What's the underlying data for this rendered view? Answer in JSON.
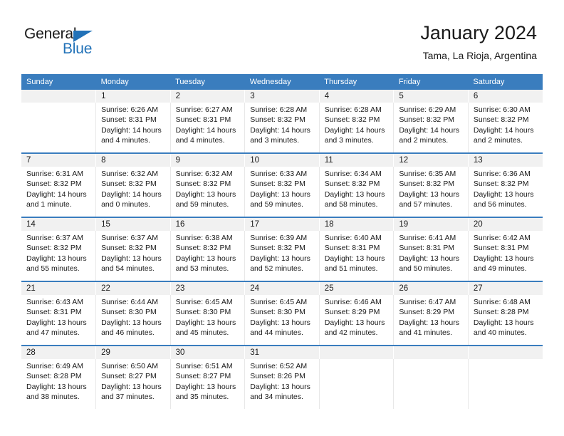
{
  "logo": {
    "word_primary": "General",
    "word_secondary": "Blue",
    "primary_color": "#1b1b1b",
    "accent_color": "#2272b8"
  },
  "header": {
    "title": "January 2024",
    "subtitle": "Tama, La Rioja, Argentina"
  },
  "theme": {
    "header_blue": "#3a7dbe",
    "daynum_gray": "#f1f1f1",
    "text": "#1a1a1a"
  },
  "weekday_headers": [
    "Sunday",
    "Monday",
    "Tuesday",
    "Wednesday",
    "Thursday",
    "Friday",
    "Saturday"
  ],
  "weeks": [
    {
      "days": [
        {
          "num": "",
          "sunrise": "",
          "sunset": "",
          "daylight1": "",
          "daylight2": ""
        },
        {
          "num": "1",
          "sunrise": "Sunrise: 6:26 AM",
          "sunset": "Sunset: 8:31 PM",
          "daylight1": "Daylight: 14 hours",
          "daylight2": "and 4 minutes."
        },
        {
          "num": "2",
          "sunrise": "Sunrise: 6:27 AM",
          "sunset": "Sunset: 8:31 PM",
          "daylight1": "Daylight: 14 hours",
          "daylight2": "and 4 minutes."
        },
        {
          "num": "3",
          "sunrise": "Sunrise: 6:28 AM",
          "sunset": "Sunset: 8:32 PM",
          "daylight1": "Daylight: 14 hours",
          "daylight2": "and 3 minutes."
        },
        {
          "num": "4",
          "sunrise": "Sunrise: 6:28 AM",
          "sunset": "Sunset: 8:32 PM",
          "daylight1": "Daylight: 14 hours",
          "daylight2": "and 3 minutes."
        },
        {
          "num": "5",
          "sunrise": "Sunrise: 6:29 AM",
          "sunset": "Sunset: 8:32 PM",
          "daylight1": "Daylight: 14 hours",
          "daylight2": "and 2 minutes."
        },
        {
          "num": "6",
          "sunrise": "Sunrise: 6:30 AM",
          "sunset": "Sunset: 8:32 PM",
          "daylight1": "Daylight: 14 hours",
          "daylight2": "and 2 minutes."
        }
      ]
    },
    {
      "days": [
        {
          "num": "7",
          "sunrise": "Sunrise: 6:31 AM",
          "sunset": "Sunset: 8:32 PM",
          "daylight1": "Daylight: 14 hours",
          "daylight2": "and 1 minute."
        },
        {
          "num": "8",
          "sunrise": "Sunrise: 6:32 AM",
          "sunset": "Sunset: 8:32 PM",
          "daylight1": "Daylight: 14 hours",
          "daylight2": "and 0 minutes."
        },
        {
          "num": "9",
          "sunrise": "Sunrise: 6:32 AM",
          "sunset": "Sunset: 8:32 PM",
          "daylight1": "Daylight: 13 hours",
          "daylight2": "and 59 minutes."
        },
        {
          "num": "10",
          "sunrise": "Sunrise: 6:33 AM",
          "sunset": "Sunset: 8:32 PM",
          "daylight1": "Daylight: 13 hours",
          "daylight2": "and 59 minutes."
        },
        {
          "num": "11",
          "sunrise": "Sunrise: 6:34 AM",
          "sunset": "Sunset: 8:32 PM",
          "daylight1": "Daylight: 13 hours",
          "daylight2": "and 58 minutes."
        },
        {
          "num": "12",
          "sunrise": "Sunrise: 6:35 AM",
          "sunset": "Sunset: 8:32 PM",
          "daylight1": "Daylight: 13 hours",
          "daylight2": "and 57 minutes."
        },
        {
          "num": "13",
          "sunrise": "Sunrise: 6:36 AM",
          "sunset": "Sunset: 8:32 PM",
          "daylight1": "Daylight: 13 hours",
          "daylight2": "and 56 minutes."
        }
      ]
    },
    {
      "days": [
        {
          "num": "14",
          "sunrise": "Sunrise: 6:37 AM",
          "sunset": "Sunset: 8:32 PM",
          "daylight1": "Daylight: 13 hours",
          "daylight2": "and 55 minutes."
        },
        {
          "num": "15",
          "sunrise": "Sunrise: 6:37 AM",
          "sunset": "Sunset: 8:32 PM",
          "daylight1": "Daylight: 13 hours",
          "daylight2": "and 54 minutes."
        },
        {
          "num": "16",
          "sunrise": "Sunrise: 6:38 AM",
          "sunset": "Sunset: 8:32 PM",
          "daylight1": "Daylight: 13 hours",
          "daylight2": "and 53 minutes."
        },
        {
          "num": "17",
          "sunrise": "Sunrise: 6:39 AM",
          "sunset": "Sunset: 8:32 PM",
          "daylight1": "Daylight: 13 hours",
          "daylight2": "and 52 minutes."
        },
        {
          "num": "18",
          "sunrise": "Sunrise: 6:40 AM",
          "sunset": "Sunset: 8:31 PM",
          "daylight1": "Daylight: 13 hours",
          "daylight2": "and 51 minutes."
        },
        {
          "num": "19",
          "sunrise": "Sunrise: 6:41 AM",
          "sunset": "Sunset: 8:31 PM",
          "daylight1": "Daylight: 13 hours",
          "daylight2": "and 50 minutes."
        },
        {
          "num": "20",
          "sunrise": "Sunrise: 6:42 AM",
          "sunset": "Sunset: 8:31 PM",
          "daylight1": "Daylight: 13 hours",
          "daylight2": "and 49 minutes."
        }
      ]
    },
    {
      "days": [
        {
          "num": "21",
          "sunrise": "Sunrise: 6:43 AM",
          "sunset": "Sunset: 8:31 PM",
          "daylight1": "Daylight: 13 hours",
          "daylight2": "and 47 minutes."
        },
        {
          "num": "22",
          "sunrise": "Sunrise: 6:44 AM",
          "sunset": "Sunset: 8:30 PM",
          "daylight1": "Daylight: 13 hours",
          "daylight2": "and 46 minutes."
        },
        {
          "num": "23",
          "sunrise": "Sunrise: 6:45 AM",
          "sunset": "Sunset: 8:30 PM",
          "daylight1": "Daylight: 13 hours",
          "daylight2": "and 45 minutes."
        },
        {
          "num": "24",
          "sunrise": "Sunrise: 6:45 AM",
          "sunset": "Sunset: 8:30 PM",
          "daylight1": "Daylight: 13 hours",
          "daylight2": "and 44 minutes."
        },
        {
          "num": "25",
          "sunrise": "Sunrise: 6:46 AM",
          "sunset": "Sunset: 8:29 PM",
          "daylight1": "Daylight: 13 hours",
          "daylight2": "and 42 minutes."
        },
        {
          "num": "26",
          "sunrise": "Sunrise: 6:47 AM",
          "sunset": "Sunset: 8:29 PM",
          "daylight1": "Daylight: 13 hours",
          "daylight2": "and 41 minutes."
        },
        {
          "num": "27",
          "sunrise": "Sunrise: 6:48 AM",
          "sunset": "Sunset: 8:28 PM",
          "daylight1": "Daylight: 13 hours",
          "daylight2": "and 40 minutes."
        }
      ]
    },
    {
      "days": [
        {
          "num": "28",
          "sunrise": "Sunrise: 6:49 AM",
          "sunset": "Sunset: 8:28 PM",
          "daylight1": "Daylight: 13 hours",
          "daylight2": "and 38 minutes."
        },
        {
          "num": "29",
          "sunrise": "Sunrise: 6:50 AM",
          "sunset": "Sunset: 8:27 PM",
          "daylight1": "Daylight: 13 hours",
          "daylight2": "and 37 minutes."
        },
        {
          "num": "30",
          "sunrise": "Sunrise: 6:51 AM",
          "sunset": "Sunset: 8:27 PM",
          "daylight1": "Daylight: 13 hours",
          "daylight2": "and 35 minutes."
        },
        {
          "num": "31",
          "sunrise": "Sunrise: 6:52 AM",
          "sunset": "Sunset: 8:26 PM",
          "daylight1": "Daylight: 13 hours",
          "daylight2": "and 34 minutes."
        },
        {
          "num": "",
          "sunrise": "",
          "sunset": "",
          "daylight1": "",
          "daylight2": ""
        },
        {
          "num": "",
          "sunrise": "",
          "sunset": "",
          "daylight1": "",
          "daylight2": ""
        },
        {
          "num": "",
          "sunrise": "",
          "sunset": "",
          "daylight1": "",
          "daylight2": ""
        }
      ]
    }
  ]
}
